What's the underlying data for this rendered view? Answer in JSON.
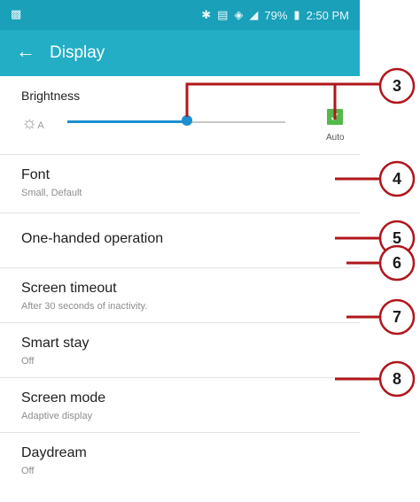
{
  "status_bar": {
    "left_icon": "photo-notification-icon",
    "icons": [
      "bluetooth-icon",
      "nfc-icon",
      "wifi-icon",
      "signal-icon"
    ],
    "battery_percent": "79%",
    "time": "2:50 PM"
  },
  "app_bar": {
    "back_icon": "back-arrow-icon",
    "title": "Display"
  },
  "brightness": {
    "label": "Brightness",
    "level": 0.55,
    "auto_checked": true,
    "auto_label": "Auto"
  },
  "menu": [
    {
      "title": "Font",
      "subtitle": "Small, Default"
    },
    {
      "title": "One-handed operation",
      "subtitle": ""
    },
    {
      "title": "Screen timeout",
      "subtitle": "After 30 seconds of inactivity."
    },
    {
      "title": "Smart stay",
      "subtitle": "Off"
    },
    {
      "title": "Screen mode",
      "subtitle": "Adaptive display"
    },
    {
      "title": "Daydream",
      "subtitle": "Off"
    }
  ],
  "callouts": [
    "3",
    "4",
    "5",
    "6",
    "7",
    "8"
  ],
  "colors": {
    "status_bar": "#1aa0b8",
    "app_bar": "#23aec5",
    "accent": "#1b8fd0",
    "checkbox": "#55b84b",
    "callout_line": "#b0161c"
  }
}
